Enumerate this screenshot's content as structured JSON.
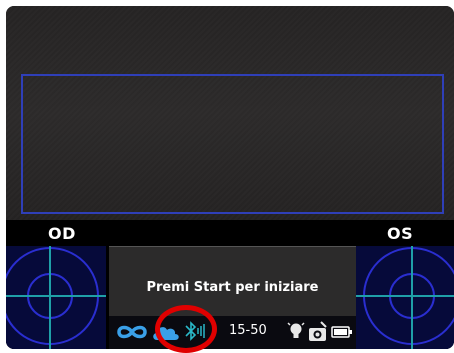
{
  "eyes": {
    "left_label": "OD",
    "right_label": "OS"
  },
  "message": {
    "text": "Premi Start per iniziare"
  },
  "status_bar": {
    "time": "15-50",
    "icons": [
      "infinity-icon",
      "cloud-icon",
      "bluetooth-icon",
      "lightbulb-icon",
      "camera-icon",
      "battery-icon"
    ]
  },
  "colors": {
    "guide_blue": "#2f3fb8",
    "target_cyan": "#1fa0a8",
    "target_ring": "#2a2ed0",
    "highlight_red": "#e00000"
  }
}
